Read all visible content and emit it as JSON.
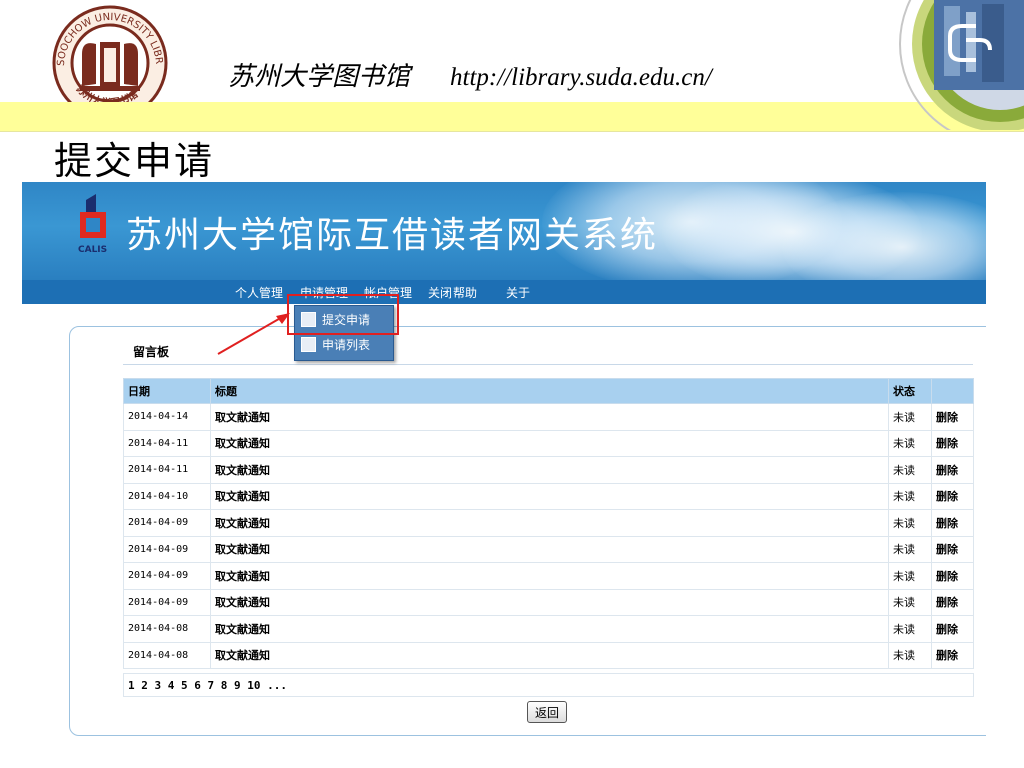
{
  "slide": {
    "library_name": "苏州大学图书馆",
    "library_url": "http://library.suda.edu.cn/",
    "title": "提交申请",
    "seal_text": "SOOCHOW UNIVERSITY LIBRARY",
    "seal_chinese": "苏州大学图书馆",
    "band_color": "#ffff99"
  },
  "app": {
    "banner_title": "苏州大学馆际互借读者网关系统",
    "calis_label": "CALIS",
    "menu": [
      "个人管理",
      "申请管理",
      "帐户管理",
      "关闭",
      "帮助",
      "关于"
    ],
    "dropdown": [
      {
        "label": "提交申请",
        "icon": "checkbox-icon"
      },
      {
        "label": "申请列表",
        "icon": "search-list-icon"
      }
    ],
    "board_title": "留言板",
    "table": {
      "headers": {
        "date": "日期",
        "title": "标题",
        "status": "状态"
      },
      "rows": [
        {
          "date": "2014-04-14",
          "title": "取文献通知",
          "status": "未读",
          "action": "删除"
        },
        {
          "date": "2014-04-11",
          "title": "取文献通知",
          "status": "未读",
          "action": "删除"
        },
        {
          "date": "2014-04-11",
          "title": "取文献通知",
          "status": "未读",
          "action": "删除"
        },
        {
          "date": "2014-04-10",
          "title": "取文献通知",
          "status": "未读",
          "action": "删除"
        },
        {
          "date": "2014-04-09",
          "title": "取文献通知",
          "status": "未读",
          "action": "删除"
        },
        {
          "date": "2014-04-09",
          "title": "取文献通知",
          "status": "未读",
          "action": "删除"
        },
        {
          "date": "2014-04-09",
          "title": "取文献通知",
          "status": "未读",
          "action": "删除"
        },
        {
          "date": "2014-04-09",
          "title": "取文献通知",
          "status": "未读",
          "action": "删除"
        },
        {
          "date": "2014-04-08",
          "title": "取文献通知",
          "status": "未读",
          "action": "删除"
        },
        {
          "date": "2014-04-08",
          "title": "取文献通知",
          "status": "未读",
          "action": "删除"
        }
      ]
    },
    "pager_text": "1 2 3 4 5 6 7 8 9 10 ...",
    "back_button": "返回",
    "colors": {
      "banner": "#2f86c6",
      "menubar": "#1d6fb4",
      "header_row": "#a8d0ef",
      "highlight": "#e02020"
    }
  }
}
